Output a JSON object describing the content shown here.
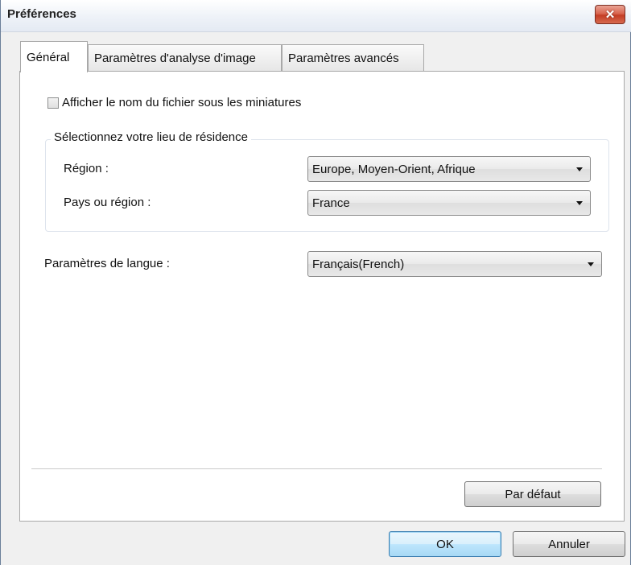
{
  "window": {
    "title": "Préférences",
    "close_symbol": "✕"
  },
  "tabs": [
    {
      "label": "Général",
      "active": true
    },
    {
      "label": "Paramètres d'analyse d'image",
      "active": false
    },
    {
      "label": "Paramètres avancés",
      "active": false
    }
  ],
  "general": {
    "show_filename_checkbox": {
      "label": "Afficher le nom du fichier sous les miniatures",
      "checked": false
    },
    "residence_group": {
      "title": "Sélectionnez votre lieu de résidence",
      "region_label": "Région :",
      "region_value": "Europe, Moyen-Orient, Afrique",
      "country_label": "Pays ou région :",
      "country_value": "France"
    },
    "language_label": "Paramètres de langue :",
    "language_value": "Français(French)",
    "default_button": "Par défaut"
  },
  "footer": {
    "ok": "OK",
    "cancel": "Annuler"
  },
  "colors": {
    "title_bar": "#eef2f8",
    "close_button": "#d9654f",
    "dialog_bg": "#f0f0f0",
    "panel_bg": "#ffffff"
  },
  "icons": {
    "close": "close-icon",
    "dropdown": "chevron-down-icon"
  }
}
